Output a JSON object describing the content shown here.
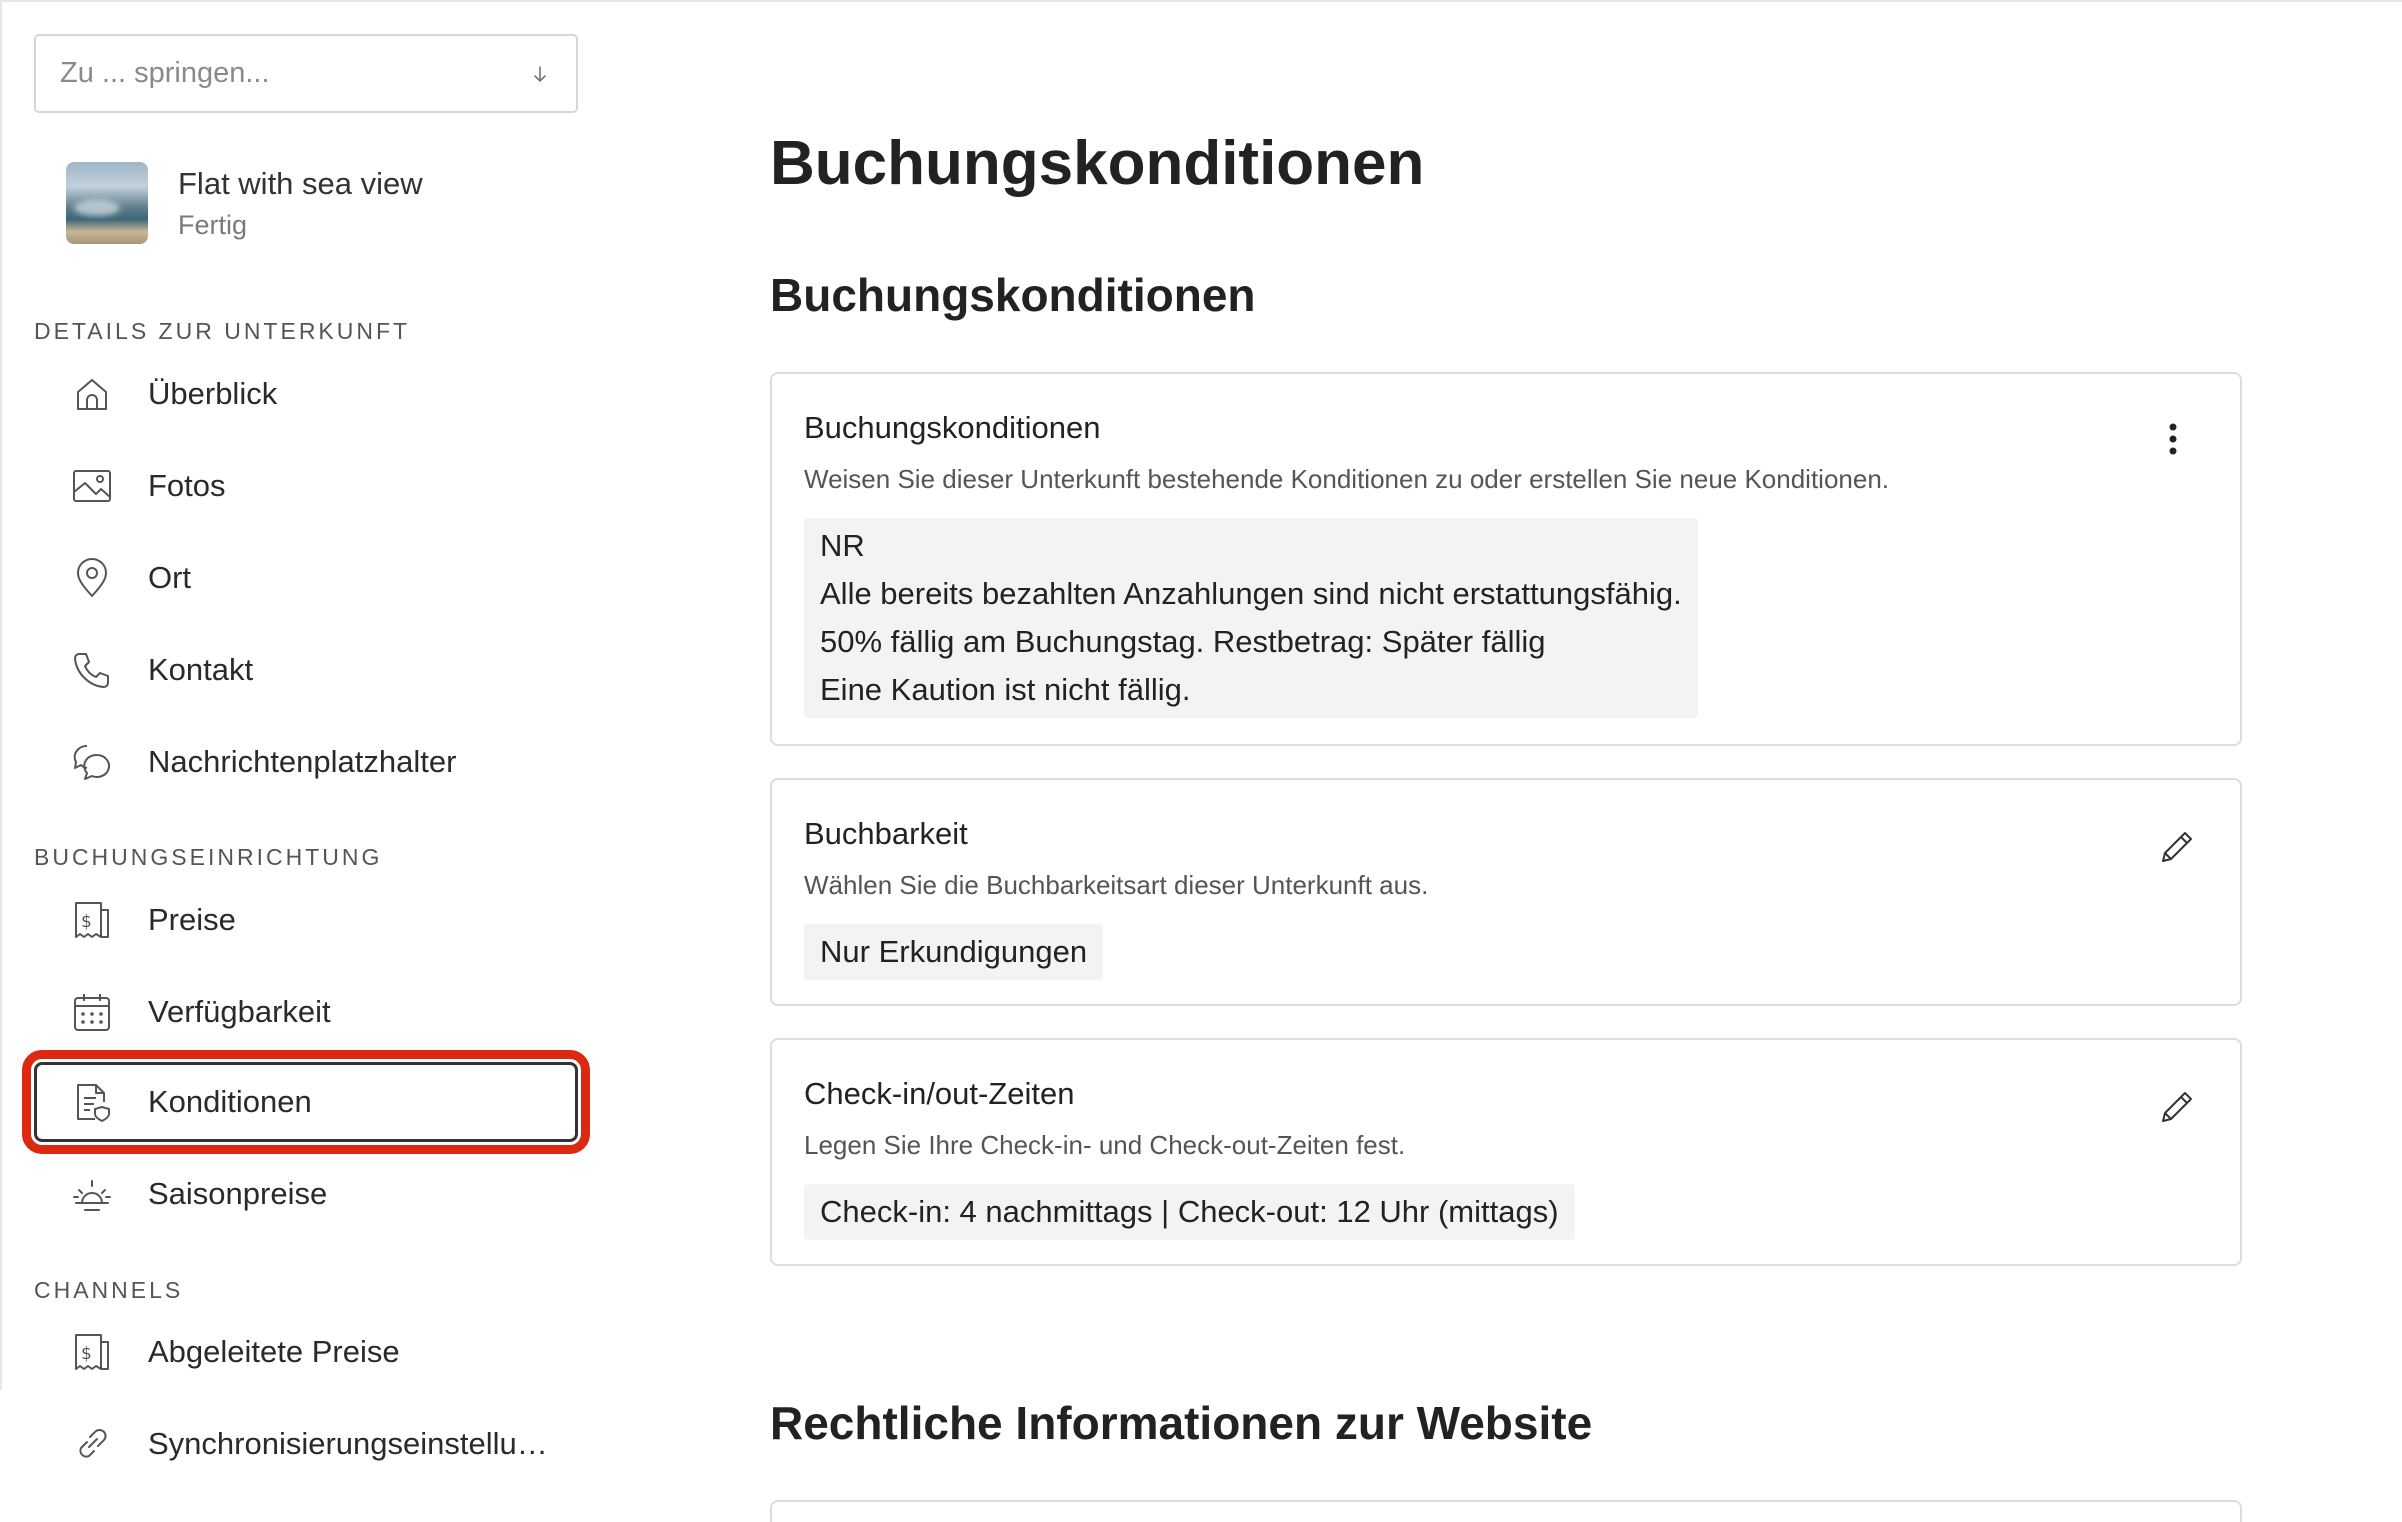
{
  "sidebar": {
    "jump": {
      "placeholder": "Zu ... springen...",
      "icon": "arrow-down-icon"
    },
    "property": {
      "name": "Flat with sea view",
      "status": "Fertig"
    },
    "sections": {
      "details": "DETAILS ZUR UNTERKUNFT",
      "booking_setup": "BUCHUNGSEINRICHTUNG",
      "channels": "CHANNELS"
    },
    "items": {
      "overview": {
        "label": "Überblick",
        "icon": "home-icon"
      },
      "photos": {
        "label": "Fotos",
        "icon": "image-icon"
      },
      "location": {
        "label": "Ort",
        "icon": "location-pin-icon"
      },
      "contact": {
        "label": "Kontakt",
        "icon": "phone-icon"
      },
      "placeholders": {
        "label": "Nachrichtenplatzhalter",
        "icon": "chat-icon"
      },
      "prices": {
        "label": "Preise",
        "icon": "price-tag-icon"
      },
      "availability": {
        "label": "Verfügbarkeit",
        "icon": "calendar-icon"
      },
      "conditions": {
        "label": "Konditionen",
        "icon": "document-shield-icon"
      },
      "seasonal": {
        "label": "Saisonpreise",
        "icon": "sun-icon"
      },
      "derived": {
        "label": "Abgeleitete Preise",
        "icon": "price-tag-icon"
      },
      "sync": {
        "label": "Synchronisierungseinstellu…",
        "icon": "link-icon"
      }
    }
  },
  "main": {
    "title": "Buchungskonditionen",
    "section1": "Buchungskonditionen",
    "section2": "Rechtliche Informationen zur Website",
    "cards": {
      "conditions": {
        "title": "Buchungskonditionen",
        "desc": "Weisen Sie dieser Unterkunft bestehende Konditionen zu oder erstellen Sie neue Konditionen.",
        "lines": [
          "NR",
          "Alle bereits bezahlten Anzahlungen sind nicht erstattungsfähig.",
          "50% fällig am Buchungstag. Restbetrag: Später fällig",
          "Eine Kaution ist nicht fällig."
        ],
        "menu_icon": "more-vertical-icon"
      },
      "bookability": {
        "title": "Buchbarkeit",
        "desc": "Wählen Sie die Buchbarkeitsart dieser Unterkunft aus.",
        "value": "Nur Erkundigungen",
        "edit_icon": "pencil-icon"
      },
      "checkin": {
        "title": "Check-in/out-Zeiten",
        "desc": "Legen Sie Ihre Check-in- und Check-out-Zeiten fest.",
        "value": "Check-in: 4 nachmittags | Check-out: 12 Uhr (mittags)",
        "edit_icon": "pencil-icon"
      }
    }
  },
  "colors": {
    "highlight": "#dc2a12",
    "text": "#222222",
    "border": "#dcdcdc",
    "chip_bg": "#f3f3f3"
  }
}
